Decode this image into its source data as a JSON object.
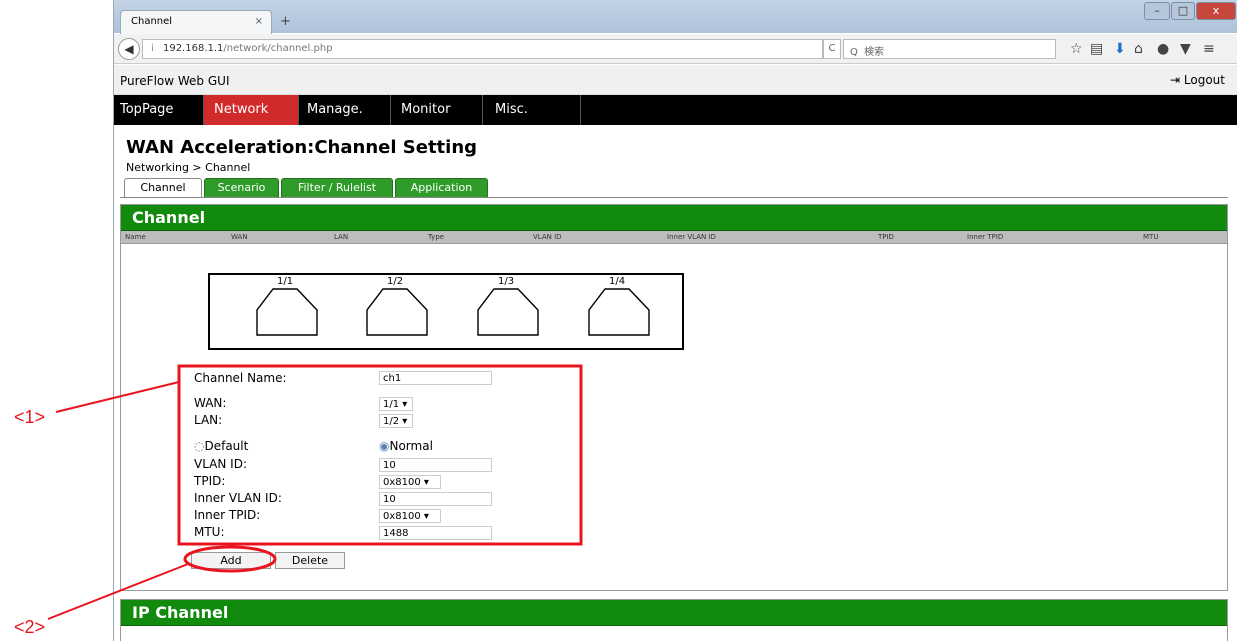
{
  "browser": {
    "tab_title": "Channel",
    "tab_close": "×",
    "new_tab": "+",
    "url_host": "192.168.1.1",
    "url_path": "/network/channel.php",
    "search_placeholder": "検索",
    "info_icon": "i",
    "reload_glyph": "C",
    "search_glyph": "Q",
    "minimize": "–",
    "maximize": "□",
    "close": "x"
  },
  "app": {
    "title": "PureFlow Web GUI",
    "logout_label": "Logout",
    "menu": [
      {
        "label": "TopPage"
      },
      {
        "label": "Network"
      },
      {
        "label": "Manage."
      },
      {
        "label": "Monitor"
      },
      {
        "label": "Misc."
      }
    ],
    "active_menu": "Network"
  },
  "page": {
    "title": "WAN Acceleration:Channel Setting",
    "breadcrumb": "Networking > Channel",
    "subtabs": [
      {
        "label": "Channel"
      },
      {
        "label": "Scenario"
      },
      {
        "label": "Filter / Rulelist"
      },
      {
        "label": "Application"
      }
    ]
  },
  "channel_panel": {
    "heading": "Channel",
    "columns": [
      "Name",
      "WAN",
      "LAN",
      "Type",
      "VLAN ID",
      "Inner VLAN ID",
      "TPID",
      "Inner TPID",
      "MTU"
    ],
    "ports": [
      "1/1",
      "1/2",
      "1/3",
      "1/4"
    ]
  },
  "form": {
    "channel_name_label": "Channel Name:",
    "channel_name_value": "ch1",
    "wan_label": "WAN:",
    "wan_value": "1/1",
    "lan_label": "LAN:",
    "lan_value": "1/2",
    "type_default_label": "Default",
    "type_normal_label": "Normal",
    "type_selected": "Normal",
    "vlan_id_label": "VLAN ID:",
    "vlan_id_value": "10",
    "tpid_label": "TPID:",
    "tpid_value": "0x8100",
    "inner_vlan_id_label": "Inner VLAN ID:",
    "inner_vlan_id_value": "10",
    "inner_tpid_label": "Inner TPID:",
    "inner_tpid_value": "0x8100",
    "mtu_label": "MTU:",
    "mtu_value": "1488",
    "add_label": "Add",
    "delete_label": "Delete"
  },
  "ip_channel_panel": {
    "heading": "IP Channel"
  },
  "annotations": {
    "label_1": "<1>",
    "label_2": "<2>",
    "color": "#e8141e"
  }
}
